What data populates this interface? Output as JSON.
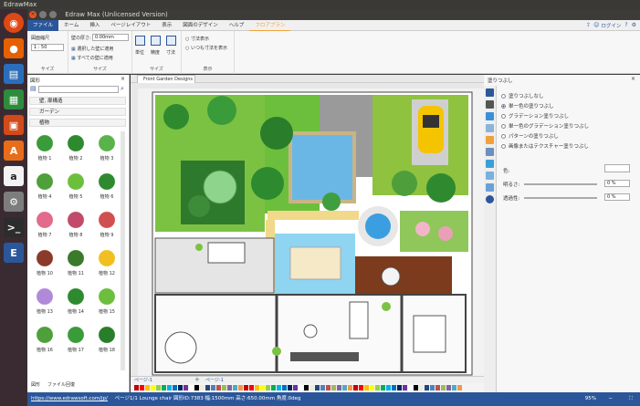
{
  "os": {
    "title": "EdrawMax"
  },
  "window": {
    "title": "Edraw Max (Unlicensed Version)"
  },
  "menu": {
    "tabs": [
      "ファイル",
      "ホーム",
      "挿入",
      "ページレイアウト",
      "表示",
      "図面のデザイン",
      "ヘルプ",
      "フロアプラン"
    ],
    "login": "ログイン"
  },
  "ribbon": {
    "scale_label": "図面縮尺",
    "scale_value": "1 : 50",
    "wall_thickness_label": "壁の厚さ:",
    "wall_thickness_value": "0.00mm",
    "apply_selected": "選択した壁に適用",
    "apply_all": "すべての壁に適用",
    "group_size1": "サイズ",
    "group_size2": "サイズ",
    "unit_label": "単位",
    "accuracy_label": "精度",
    "dimension_label": "寸法",
    "dimension_show": "寸法表示",
    "always_show": "いつも寸法を表示",
    "group_size3": "サイズ",
    "group_display": "表示"
  },
  "left_panel": {
    "header": "図形",
    "libraries": [
      "壁, 扉構造",
      "ガーデン",
      "植物"
    ],
    "symbols": [
      "植物 1",
      "植物 2",
      "植物 3",
      "植物 4",
      "植物 5",
      "植物 6",
      "植物 7",
      "植物 8",
      "植物 9",
      "植物 10",
      "植物 11",
      "植物 12",
      "植物 13",
      "植物 14",
      "植物 15",
      "植物 16",
      "植物 17",
      "植物 18"
    ],
    "tabs": [
      "図形",
      "ファイル回復"
    ]
  },
  "document": {
    "tab": "Front Garden Designs",
    "page_tab": "ページ-1",
    "page_tab2": "ページ-1"
  },
  "right_panel": {
    "header": "塗りつぶし",
    "options": [
      "塗りつぶしなし",
      "単一色の塗りつぶし",
      "グラデーション塗りつぶし",
      "単一色のグラデーション塗りつぶし",
      "パターンの塗りつぶし",
      "画像またはテクスチャー塗りつぶし"
    ],
    "selected": 1,
    "color_label": "色:",
    "brightness_label": "明るさ:",
    "brightness_value": "0 %",
    "transparency_label": "透過性:",
    "transparency_value": "0 %"
  },
  "status": {
    "url": "https://www.edrawsoft.com/jp/",
    "info": "ページ1/1  Lounge chair  図形ID:7383  幅:1500mm  高さ:650.00mm  角度:0deg",
    "zoom": "95%"
  }
}
